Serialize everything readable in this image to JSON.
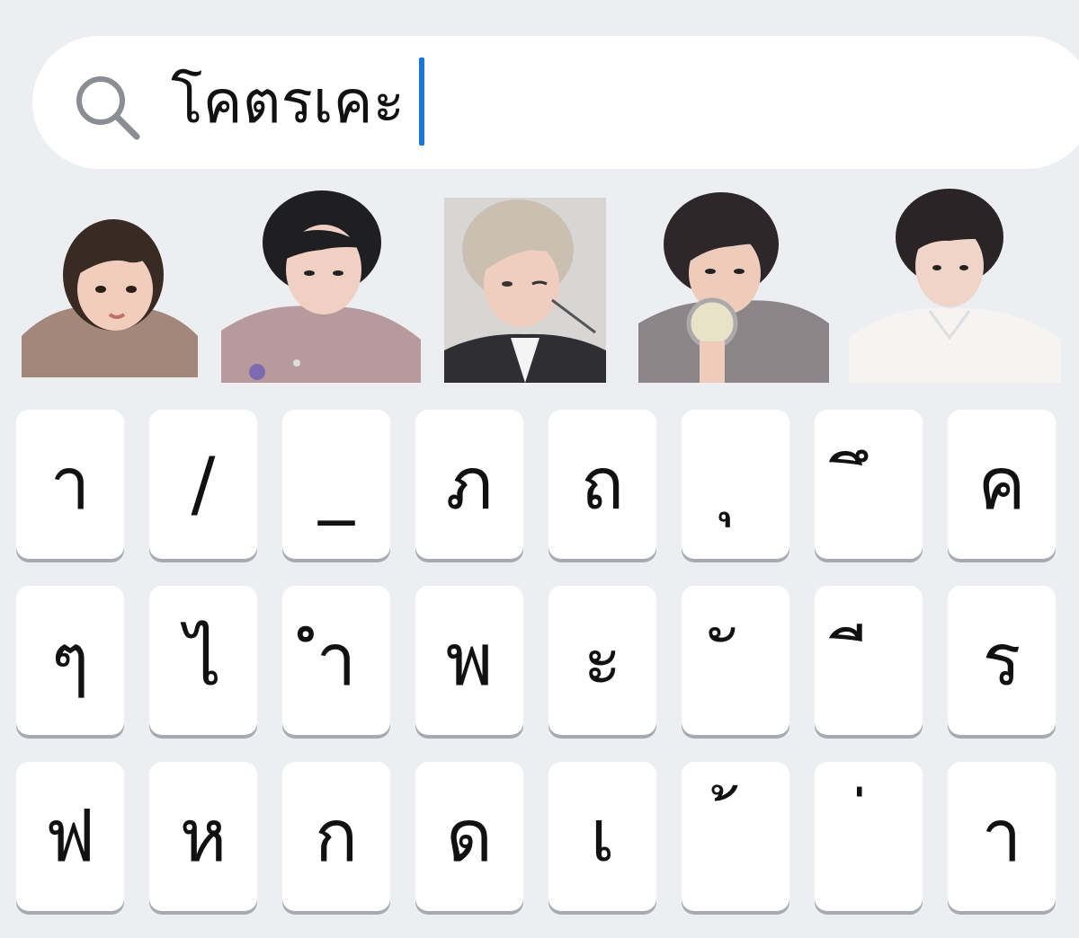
{
  "search": {
    "query": "โคตรเคะ",
    "icon": "search-icon"
  },
  "stickers": [
    {
      "name": "sticker-boy-beige-sweater"
    },
    {
      "name": "sticker-boy-pink-sweater"
    },
    {
      "name": "sticker-boy-blonde-wink"
    },
    {
      "name": "sticker-boy-holding-flashlight"
    },
    {
      "name": "sticker-boy-white-shirt"
    }
  ],
  "keyboard": {
    "rows": [
      [
        "า",
        "/",
        "_",
        "ภ",
        "ถ",
        "ุ",
        "ึ",
        "ค"
      ],
      [
        "ๆ",
        "ไ",
        "ำ",
        "พ",
        "ะ",
        "ั",
        "ี",
        "ร"
      ],
      [
        "ฟ",
        "ห",
        "ก",
        "ด",
        "เ",
        "้",
        "่",
        "า"
      ]
    ]
  },
  "colors": {
    "background": "#eceef1",
    "key": "#ffffff",
    "caret": "#1976d2"
  }
}
